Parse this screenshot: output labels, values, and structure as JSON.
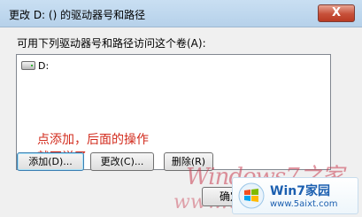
{
  "window": {
    "title": "更改 D: () 的驱动器号和路径",
    "close_glyph": "X"
  },
  "content": {
    "label": "可用下列驱动器号和路径访问这个卷(A):",
    "list_items": [
      {
        "label": "D:",
        "icon": "drive-icon"
      }
    ],
    "annotation_lines": [
      "点添加，后面的操作",
      "就不说了"
    ]
  },
  "buttons": {
    "add": "添加(D)...",
    "change": "更改(C)...",
    "delete": "删除(R)",
    "ok": "确定"
  },
  "watermark": {
    "line1": "Windows7之家",
    "line2": "www.wi"
  },
  "logo": {
    "title": "Win7家园",
    "url": "www.5aixt.com"
  },
  "colors": {
    "annotation": "#d22b1d",
    "close_button": "#c75039",
    "logo_text": "#1b5fb0"
  }
}
